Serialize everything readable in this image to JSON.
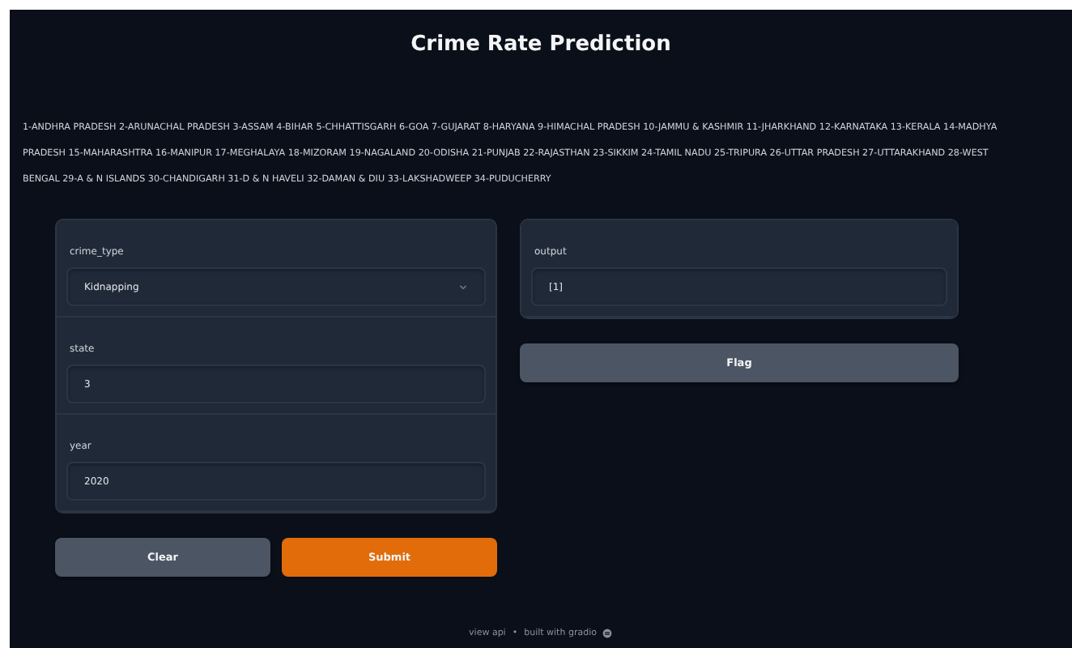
{
  "title": "Crime Rate Prediction",
  "description": "1-ANDHRA PRADESH 2-ARUNACHAL PRADESH 3-ASSAM 4-BIHAR 5-CHHATTISGARH 6-GOA 7-GUJARAT 8-HARYANA 9-HIMACHAL PRADESH 10-JAMMU & KASHMIR 11-JHARKHAND 12-KARNATAKA 13-KERALA 14-MADHYA PRADESH 15-MAHARASHTRA 16-MANIPUR 17-MEGHALAYA 18-MIZORAM 19-NAGALAND 20-ODISHA 21-PUNJAB 22-RAJASTHAN 23-SIKKIM 24-TAMIL NADU 25-TRIPURA 26-UTTAR PRADESH 27-UTTARAKHAND 28-WEST BENGAL 29-A & N ISLANDS 30-CHANDIGARH 31-D & N HAVELI 32-DAMAN & DIU 33-LAKSHADWEEP 34-PUDUCHERRY",
  "inputs": [
    {
      "label": "crime_type",
      "kind": "dropdown",
      "value": "Kidnapping"
    },
    {
      "label": "state",
      "kind": "textbox",
      "value": "3"
    },
    {
      "label": "year",
      "kind": "textbox",
      "value": "2020"
    }
  ],
  "input_buttons": [
    {
      "label": "Clear",
      "kind": "secondary"
    },
    {
      "label": "Submit",
      "kind": "primary"
    }
  ],
  "output": {
    "label": "output",
    "value": "[1]"
  },
  "output_buttons": [
    {
      "label": "Flag",
      "kind": "secondary"
    }
  ],
  "footer": {
    "api_link": "view api",
    "separator": "•",
    "built_with": "built with gradio"
  }
}
